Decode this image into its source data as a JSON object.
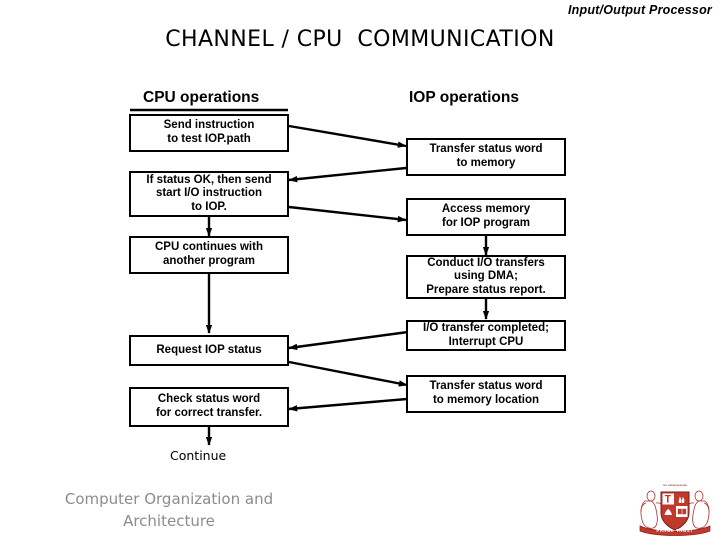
{
  "slide": {
    "header": "Input/Output Processor",
    "title": "CHANNEL / CPU  COMMUNICATION",
    "footer": "Computer Organization and\nArchitecture"
  },
  "columns": {
    "cpu_heading": "CPU operations",
    "iop_heading": "IOP operations"
  },
  "cpu_steps": [
    {
      "text": "Send instruction\nto test IOP.path"
    },
    {
      "text": "If status OK, then send\nstart I/O instruction\nto IOP."
    },
    {
      "text": "CPU continues with\nanother program"
    },
    {
      "text": "Request IOP status"
    },
    {
      "text": "Check status word\nfor correct transfer."
    }
  ],
  "cpu_end": "Continue",
  "iop_steps": [
    {
      "text": "Transfer status word\nto memory"
    },
    {
      "text": "Access memory\nfor IOP program"
    },
    {
      "text": "Conduct I/O transfers\nusing DMA;\nPrepare status report."
    },
    {
      "text": "I/O transfer completed;\nInterrupt CPU"
    },
    {
      "text": "Transfer status word\nto memory location"
    }
  ],
  "logo": {
    "banner_text": "PARUL TRUST",
    "motto": "om sahanavavatu"
  },
  "colors": {
    "ink": "#000000",
    "footer_gray": "#8c8c8c",
    "logo_red": "#c0392b",
    "logo_gold": "#e8b84b"
  }
}
